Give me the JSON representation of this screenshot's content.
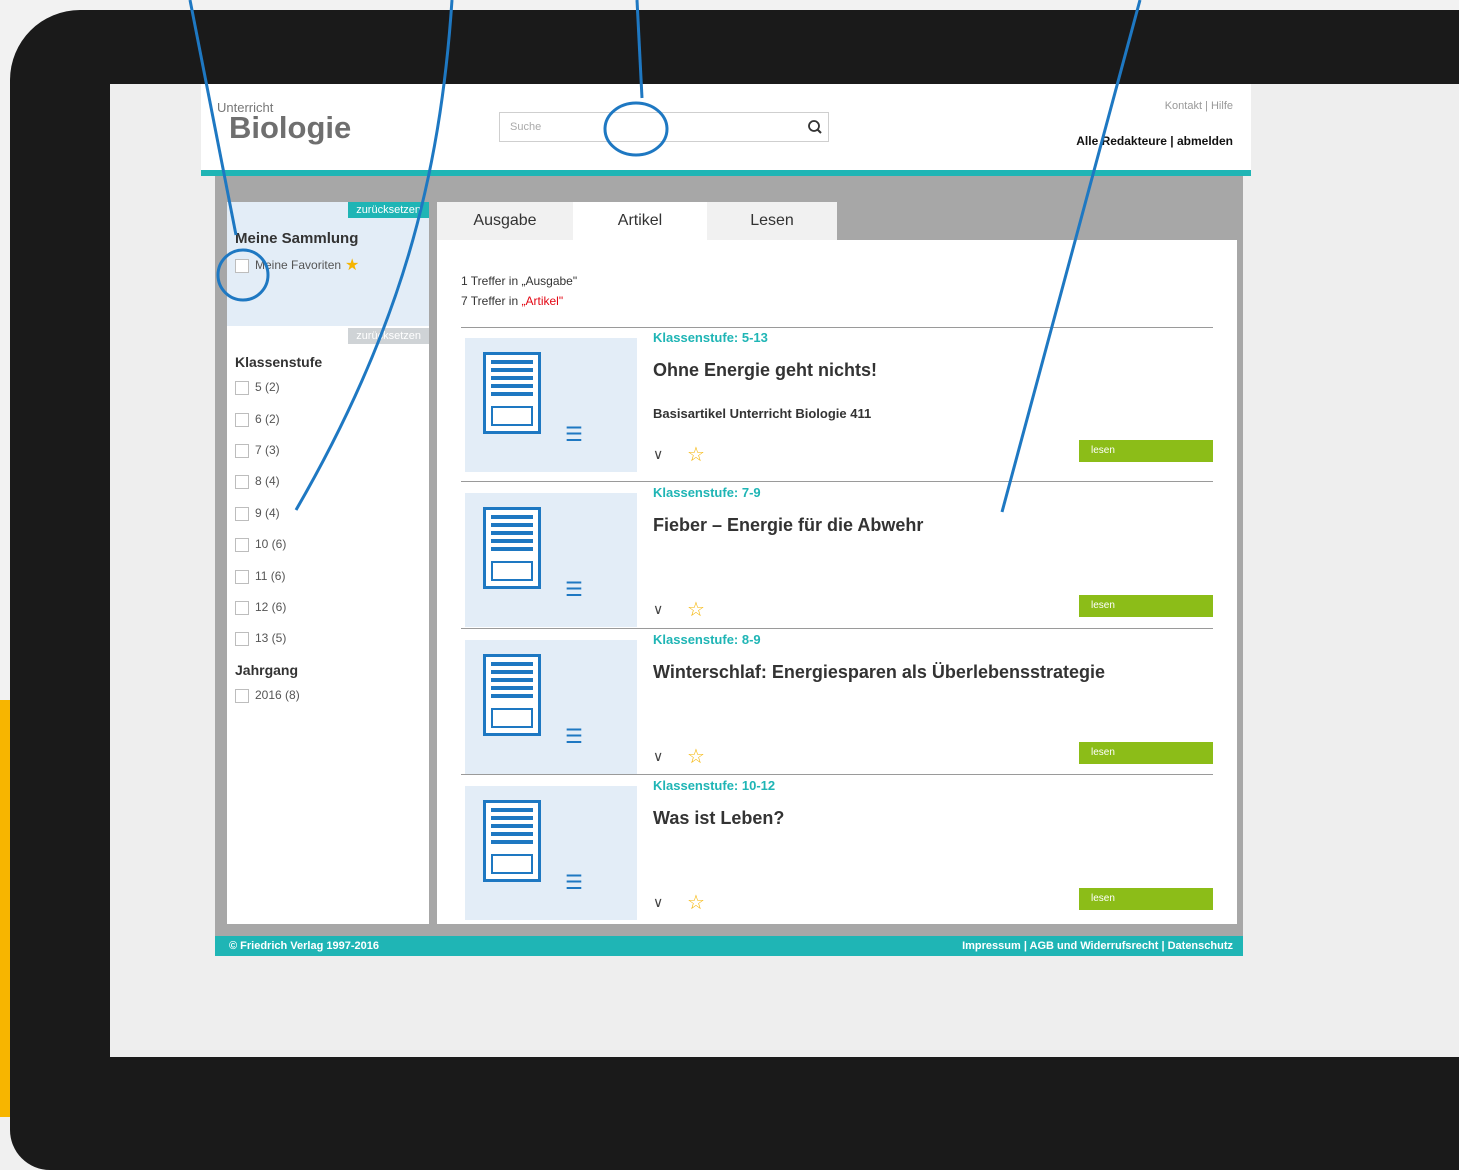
{
  "logo": {
    "top": "Unterricht",
    "main": "Biologie"
  },
  "search": {
    "placeholder": "Suche"
  },
  "toplinks": "Kontakt | Hilfe",
  "userlinks": "Alle Redakteure | abmelden",
  "sidebar": {
    "reset_label": "zurücksetzen",
    "collection_title": "Meine Sammlung",
    "favorites_label": "Meine Favoriten",
    "grade_title": "Klassenstufe",
    "grades": [
      "5 (2)",
      "6 (2)",
      "7 (3)",
      "8 (4)",
      "9 (4)",
      "10 (6)",
      "11 (6)",
      "12 (6)",
      "13 (5)"
    ],
    "year_title": "Jahrgang",
    "years": [
      "2016 (8)"
    ]
  },
  "tabs": [
    "Ausgabe",
    "Artikel",
    "Lesen"
  ],
  "results": {
    "line1": "1 Treffer in „Ausgabe\"",
    "line2_prefix": "7 Treffer in ",
    "line2_highlight": "„Artikel\""
  },
  "articles": [
    {
      "level": "Klassenstufe: 5-13",
      "title": "Ohne Energie geht nichts!",
      "subtitle": "Basisartikel Unterricht Biologie 411",
      "button": "lesen"
    },
    {
      "level": "Klassenstufe: 7-9",
      "title": "Fieber – Energie für die Abwehr",
      "subtitle": "",
      "button": "lesen"
    },
    {
      "level": "Klassenstufe: 8-9",
      "title": "Winterschlaf: Energiesparen als Überlebensstrategie",
      "subtitle": "",
      "button": "lesen"
    },
    {
      "level": "Klassenstufe: 10-12",
      "title": "Was ist Leben?",
      "subtitle": "",
      "button": "lesen"
    }
  ],
  "footer": {
    "copyright": "© Friedrich Verlag 1997-2016",
    "links": "Impressum | AGB und Widerrufsrecht | Datenschutz"
  },
  "colors": {
    "teal": "#1fb5b5",
    "green": "#8cbd18",
    "blue": "#1e78c2",
    "star": "#f5b400",
    "highlight_red": "#e30613"
  },
  "icons": [
    "search-icon",
    "star-icon",
    "document-icon",
    "list-icon",
    "chevron-down-icon"
  ]
}
